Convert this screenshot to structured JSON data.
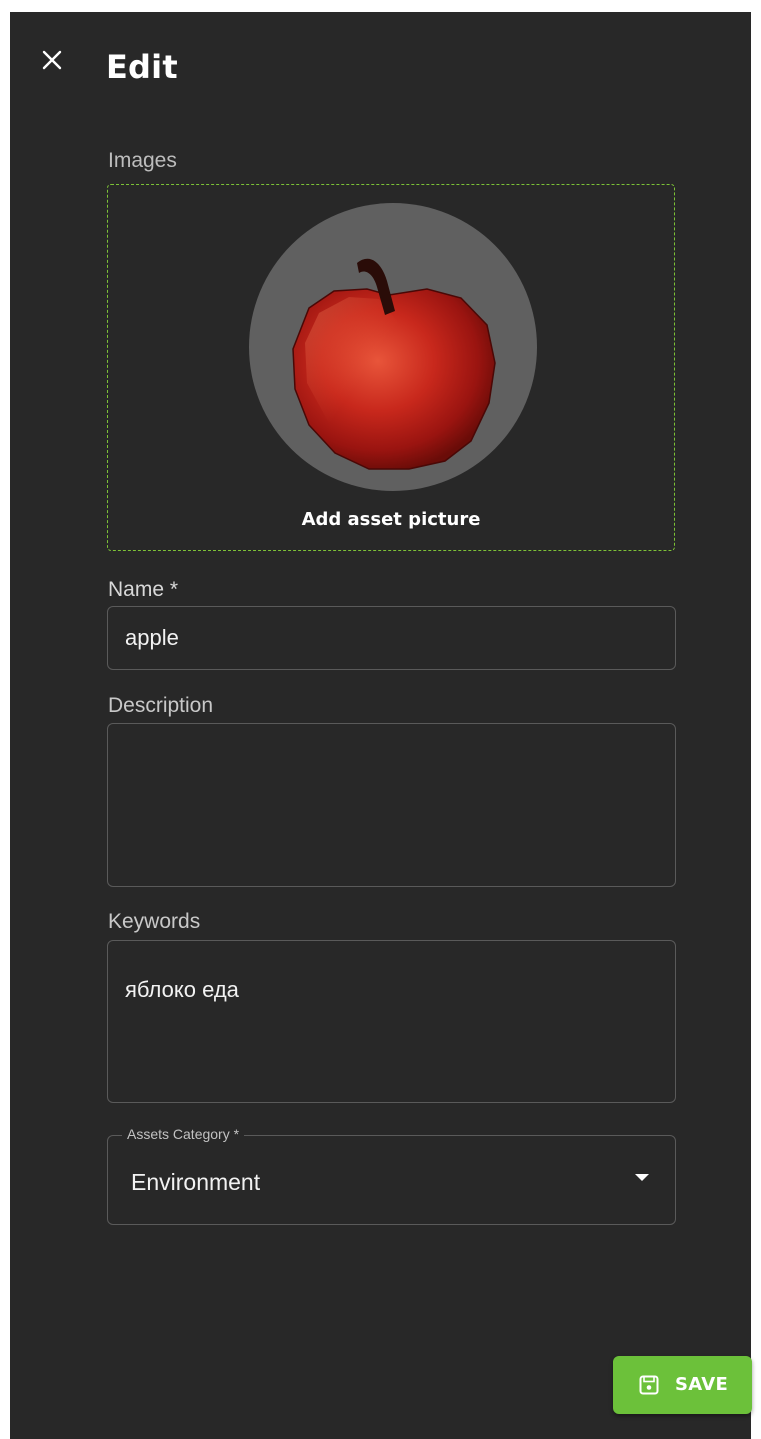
{
  "header": {
    "title": "Edit",
    "close_icon": "close-icon"
  },
  "images": {
    "label": "Images",
    "add_picture_label": "Add asset picture",
    "picture_icon": "apple-icon"
  },
  "name_field": {
    "label": "Name *",
    "value": "apple"
  },
  "description_field": {
    "label": "Description",
    "value": ""
  },
  "keywords_field": {
    "label": "Keywords",
    "value": "яблоко еда"
  },
  "category_select": {
    "label": "Assets Category *",
    "selected": "Environment",
    "caret_icon": "caret-down-icon"
  },
  "save_button": {
    "label": "SAVE",
    "icon": "save-icon"
  },
  "colors": {
    "panel_background": "#282828",
    "accent_green": "#6cc13a",
    "dropzone_border": "#7cc236",
    "avatar_circle": "#606060"
  }
}
